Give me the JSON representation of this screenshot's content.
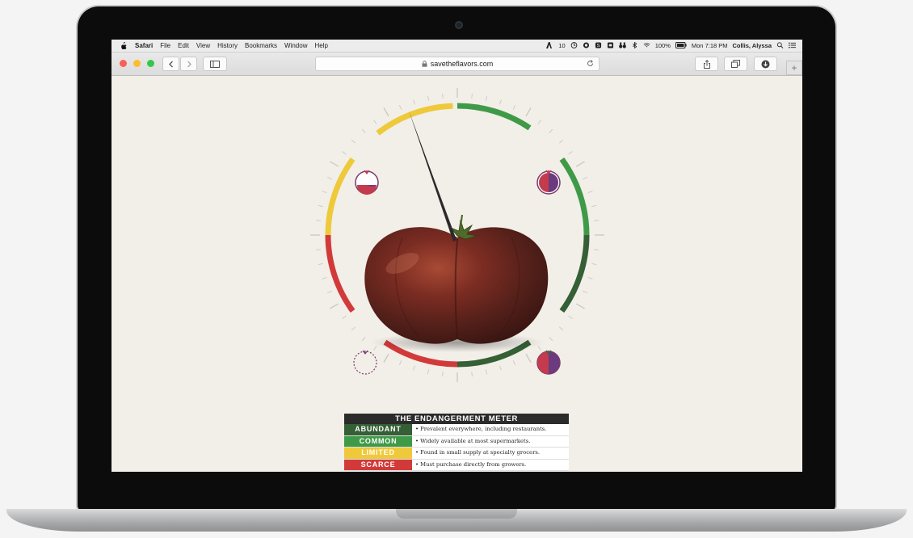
{
  "menubar": {
    "app_name": "Safari",
    "items": [
      "File",
      "Edit",
      "View",
      "History",
      "Bookmarks",
      "Window",
      "Help"
    ],
    "status_count": "10",
    "battery": "100%",
    "clock": "Mon 7:18 PM",
    "user": "Collis, Alyssa"
  },
  "browser": {
    "url": "savetheflavors.com",
    "new_tab_symbol": "+",
    "traffic_lights": [
      "#fc5f57",
      "#fdbc2e",
      "#34c84a"
    ]
  },
  "meter": {
    "title": "THE ENDANGERMENT METER",
    "gauge_colors": {
      "scarce": "#d23a3a",
      "limited": "#eec93a",
      "common": "#3f9a48",
      "abundant": "#355f35"
    },
    "levels": [
      {
        "label": "ABUNDANT",
        "color": "#355f35",
        "description": "• Prevalent everywhere, including restaurants."
      },
      {
        "label": "COMMON",
        "color": "#3f9a48",
        "description": "• Widely available at most supermarkets."
      },
      {
        "label": "LIMITED",
        "color": "#eec93a",
        "description": "• Found in small supply at specialty grocers."
      },
      {
        "label": "SCARCE",
        "color": "#d23a3a",
        "description": "• Must purchase directly from growers."
      }
    ]
  }
}
